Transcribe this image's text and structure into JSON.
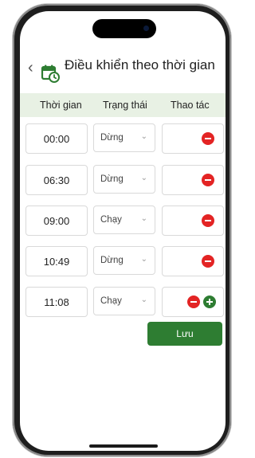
{
  "header": {
    "title": "Điều khiển theo thời gian",
    "back_icon": "chevron-left-icon",
    "title_icon": "calendar-clock-icon",
    "accent_color": "#2e7d32"
  },
  "table": {
    "columns": [
      "Thời gian",
      "Trạng thái",
      "Thao tác"
    ],
    "rows": [
      {
        "time": "00:00",
        "status": "Dừng"
      },
      {
        "time": "06:30",
        "status": "Dừng"
      },
      {
        "time": "09:00",
        "status": "Chạy"
      },
      {
        "time": "10:49",
        "status": "Dừng"
      },
      {
        "time": "11:08",
        "status": "Chạy"
      }
    ]
  },
  "actions": {
    "save_label": "Lưu",
    "remove_color": "#e32424",
    "add_color": "#2e7d32"
  }
}
